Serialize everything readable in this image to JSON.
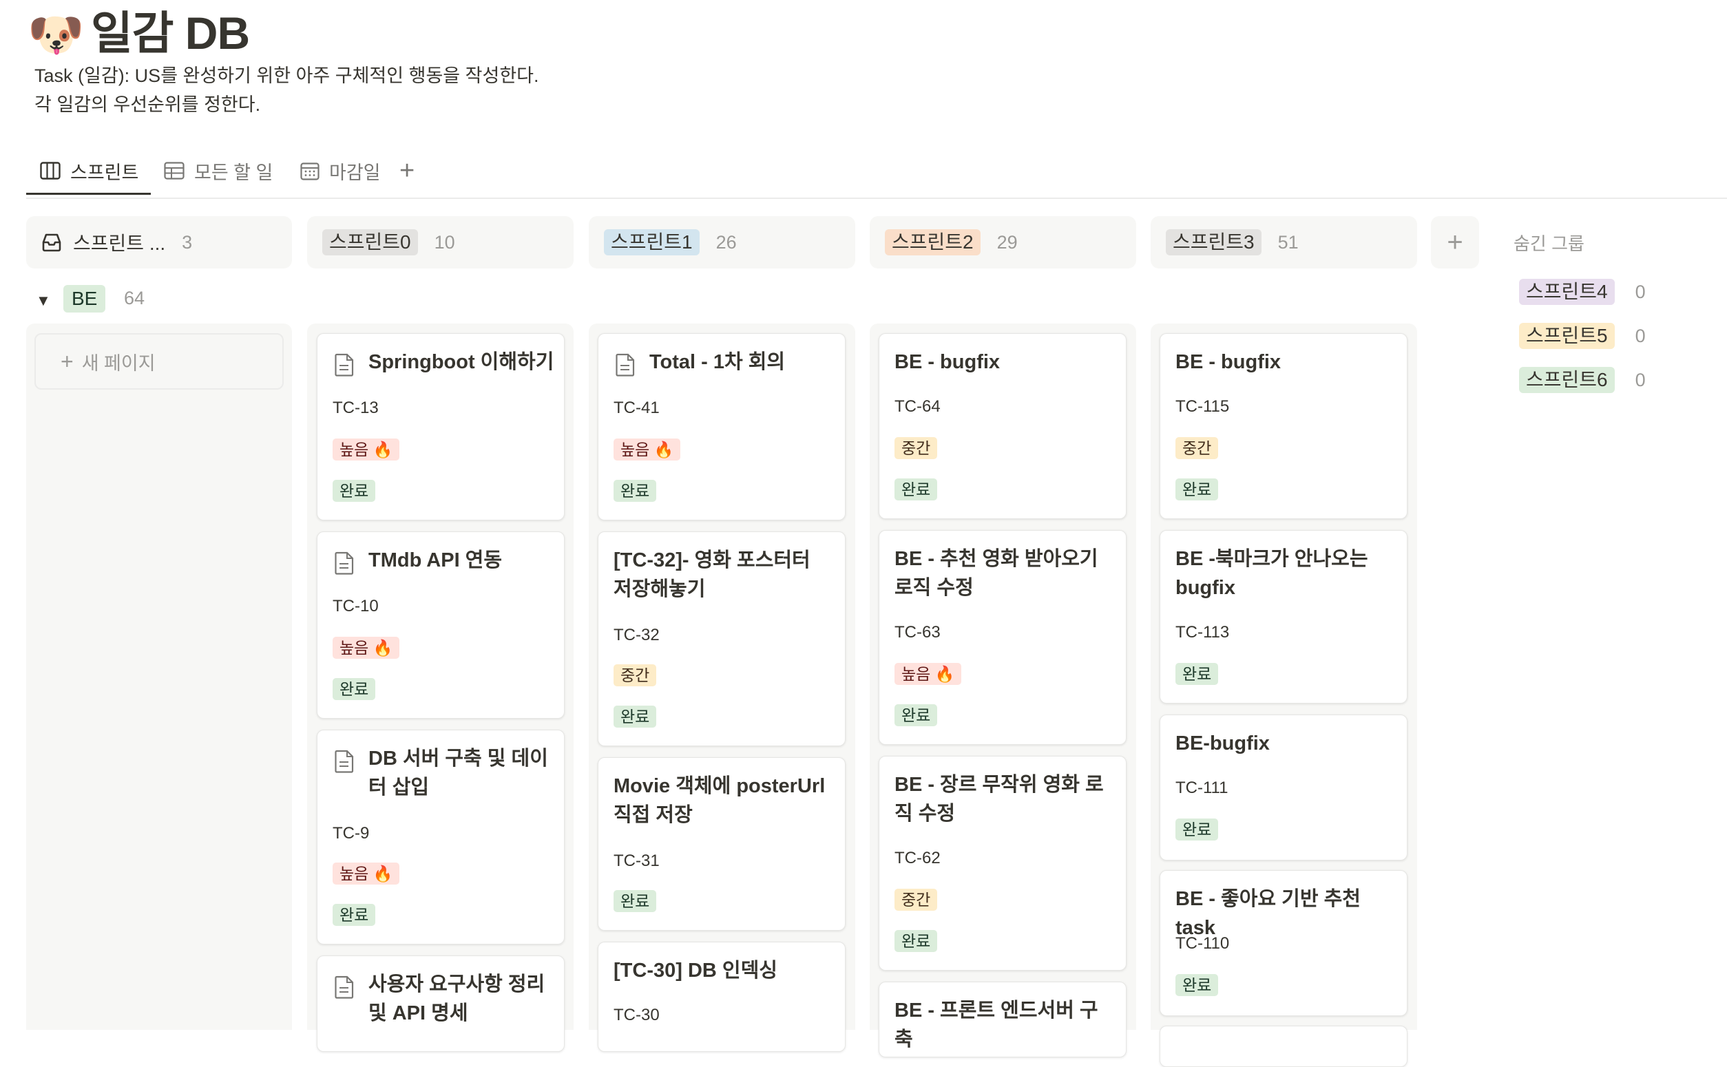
{
  "page": {
    "icon": "🐶",
    "title": "일감 DB",
    "description": [
      "Task (일감): US를 완성하기 위한 아주 구체적인 행동을 작성한다.",
      "각 일감의 우선순위를 정한다."
    ]
  },
  "tabs": [
    {
      "icon": "board-icon",
      "label": "스프린트",
      "active": true
    },
    {
      "icon": "table-icon",
      "label": "모든 할 일",
      "active": false
    },
    {
      "icon": "calendar-icon",
      "label": "마감일",
      "active": false
    }
  ],
  "add_tab_label": "+",
  "columns": [
    {
      "label": "스프린트 ...",
      "count": "3",
      "color": "#f7f7f5"
    },
    {
      "label": "스프린트0",
      "count": "10",
      "color": "#e3e2e0"
    },
    {
      "label": "스프린트1",
      "count": "26",
      "color": "#d3e5ef"
    },
    {
      "label": "스프린트2",
      "count": "29",
      "color": "#fadec9"
    },
    {
      "label": "스프린트3",
      "count": "51",
      "color": "#e3e2e0"
    }
  ],
  "add_column_label": "+",
  "group": {
    "label": "BE",
    "count": "64"
  },
  "new_page_label": "새 페이지",
  "cards": {
    "col0": [
      {
        "title": "Springboot 이해하기",
        "id": "TC-13",
        "priority": "높음 🔥",
        "status": "완료"
      },
      {
        "title": "TMdb API 연동",
        "id": "TC-10",
        "priority": "높음 🔥",
        "status": "완료"
      },
      {
        "title": "DB 서버 구축 및 데이터 삽입",
        "id": "TC-9",
        "priority": "높음 🔥",
        "status": "완료"
      },
      {
        "title": "사용자 요구사항 정리 및 API 명세"
      }
    ],
    "col1": [
      {
        "title": "Total - 1차 회의",
        "id": "TC-41",
        "priority": "높음 🔥",
        "status": "완료"
      },
      {
        "title": "[TC-32]- 영화 포스터터 저장해놓기",
        "id": "TC-32",
        "priority": "중간",
        "status": "완료"
      },
      {
        "title": "Movie 객체에 posterUrl 직접 저장",
        "id": "TC-31",
        "status": "완료"
      },
      {
        "title": "[TC-30] DB 인덱싱",
        "id": "TC-30"
      }
    ],
    "col2": [
      {
        "title": "BE - bugfix",
        "id": "TC-64",
        "priority": "중간",
        "status": "완료"
      },
      {
        "title": "BE - 추천 영화 받아오기 로직 수정",
        "id": "TC-63",
        "priority": "높음 🔥",
        "status": "완료"
      },
      {
        "title": "BE - 장르 무작위 영화 로직 수정",
        "id": "TC-62",
        "priority": "중간",
        "status": "완료"
      },
      {
        "title": "BE - 프론트 엔드서버 구축"
      }
    ],
    "col3": [
      {
        "title": "BE - bugfix",
        "id": "TC-115",
        "priority": "중간",
        "status": "완료"
      },
      {
        "title": "BE -북마크가 안나오는 bugfix",
        "id": "TC-113",
        "status": "완료"
      },
      {
        "title": "BE-bugfix",
        "id": "TC-111",
        "status": "완료"
      },
      {
        "title": "BE - 좋아요 기반 추천 task",
        "id": "TC-110",
        "status": "완료"
      }
    ]
  },
  "hidden_groups": {
    "title": "숨긴 그룹",
    "items": [
      {
        "label": "스프린트4",
        "count": "0",
        "color": "#e8deee"
      },
      {
        "label": "스프린트5",
        "count": "0",
        "color": "#fdecc8"
      },
      {
        "label": "스프린트6",
        "count": "0",
        "color": "#dbeddb"
      }
    ]
  }
}
